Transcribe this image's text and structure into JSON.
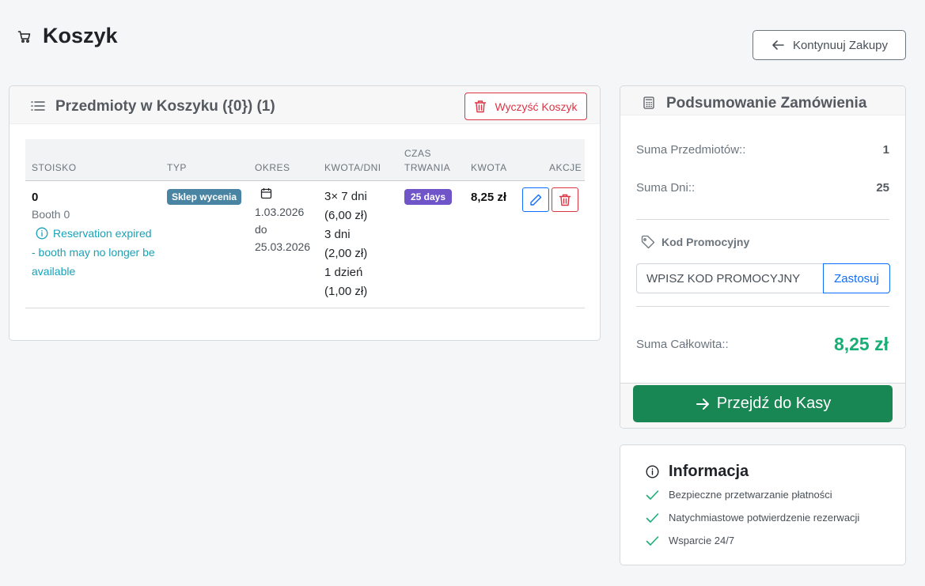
{
  "header": {
    "title": "Koszyk",
    "continue_label": "Kontynuuj Zakupy"
  },
  "items_card": {
    "title": "Przedmioty w Koszyku ({0}) (1)",
    "clear_label": "Wyczyść Koszyk",
    "columns": {
      "stall": "STOISKO",
      "type": "TYP",
      "period": "OKRES",
      "amount_days": "KWOTA/DNI",
      "duration_line1": "CZAS",
      "duration_line2": "TRWANIA",
      "amount": "KWOTA",
      "actions": "AKCJE"
    },
    "rows": [
      {
        "stall_number": "0",
        "booth_name": "Booth 0",
        "warning": "Reservation expired - booth may no longer be available",
        "type": "Sklep wycenia",
        "period_start": "1.03.2026",
        "period_to": "do",
        "period_end": "25.03.2026",
        "amount_lines": [
          "3× 7 dni",
          "(6,00 zł)",
          "3 dni",
          "(2,00 zł)",
          "1 dzień",
          "(1,00 zł)"
        ],
        "duration": "25 days",
        "amount": "8,25 zł"
      }
    ]
  },
  "summary": {
    "title": "Podsumowanie Zamówienia",
    "items_label": "Suma Przedmiotów::",
    "items_value": "1",
    "days_label": "Suma Dni::",
    "days_value": "25",
    "promo_label": "Kod Promocyjny",
    "promo_placeholder": "WPISZ KOD PROMOCYJNY",
    "apply_label": "Zastosuj",
    "total_label": "Suma Całkowita::",
    "total_value": "8,25 zł",
    "checkout_label": "Przejdź do Kasy"
  },
  "info": {
    "title": "Informacja",
    "items": [
      "Bezpieczne przetwarzanie płatności",
      "Natychmiastowe potwierdzenie rezerwacji",
      "Wsparcie 24/7"
    ]
  },
  "colors": {
    "type_badge": "#4a84a3",
    "duration_badge": "#6f55c8",
    "checkout": "#198754",
    "total": "#1aae77",
    "danger": "#dc3545",
    "primary": "#0d6efd",
    "info": "#17a2b8"
  },
  "icons": [
    "cart-icon",
    "arrow-left-icon",
    "list-icon",
    "trash-icon",
    "info-icon",
    "calendar-icon",
    "pencil-icon",
    "calculator-icon",
    "tag-icon",
    "arrow-right-icon",
    "check-icon"
  ]
}
